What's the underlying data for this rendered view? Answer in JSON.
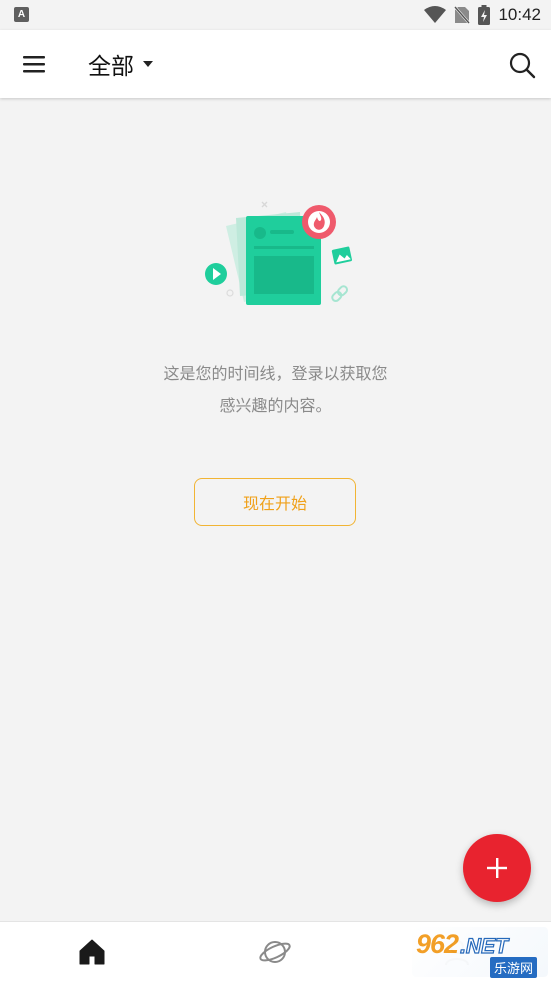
{
  "status_bar": {
    "notification_icon": "A",
    "time": "10:42",
    "icons": [
      "wifi-icon",
      "no-sim-icon",
      "battery-charging-icon"
    ]
  },
  "app_bar": {
    "title": "全部",
    "icons": [
      "menu-icon",
      "dropdown-arrow-icon",
      "search-icon"
    ]
  },
  "empty_state": {
    "illustration": "timeline-illustration",
    "message_line1": "这是您的时间线，登录以获取您",
    "message_line2": "感兴趣的内容。",
    "button_label": "现在开始"
  },
  "fab": {
    "icon": "plus-icon"
  },
  "bottom_nav": {
    "items": [
      {
        "icon": "home-icon",
        "active": true
      },
      {
        "icon": "planet-icon",
        "active": false
      },
      {
        "icon": "profile-icon",
        "active": false
      }
    ]
  },
  "watermark": {
    "top_number": "962",
    "top_suffix": ".NET",
    "bottom_text": "乐游网"
  },
  "colors": {
    "background": "#f3f3f3",
    "accent": "#f0a11a",
    "fab": "#e8232f",
    "illustration_green": "#1fce9c",
    "illustration_red": "#ef5a6c"
  }
}
